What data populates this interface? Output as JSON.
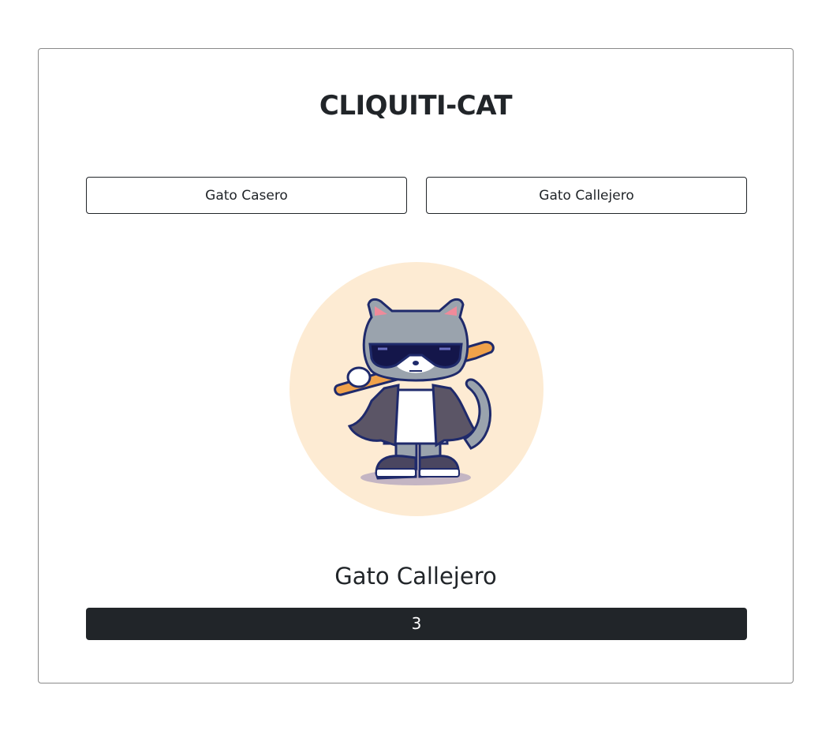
{
  "app": {
    "title": "CLIQUITI-CAT"
  },
  "buttons": {
    "home_cat": "Gato Casero",
    "street_cat": "Gato Callejero"
  },
  "selected_cat": {
    "name": "Gato Callejero",
    "image_icon": "street-cat-illustration",
    "background_color": "#fdebd3"
  },
  "counter": {
    "value": "3"
  },
  "colors": {
    "text": "#212529",
    "counter_bg": "#212529",
    "counter_text": "#ffffff"
  }
}
